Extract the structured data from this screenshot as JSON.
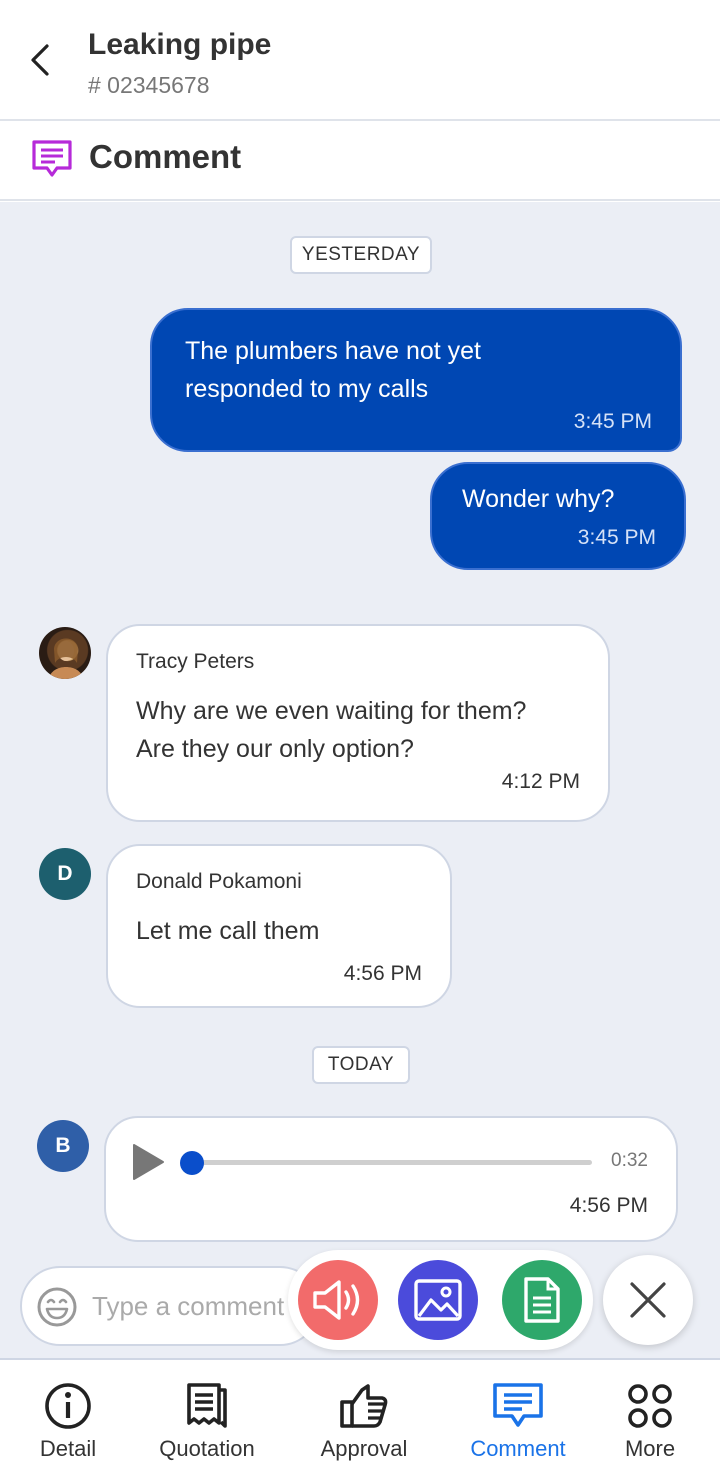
{
  "header": {
    "title": "Leaking pipe",
    "ticket": "# 02345678"
  },
  "section": {
    "title": "Comment",
    "icon": "comment-icon",
    "icon_color": "#b62ad9"
  },
  "dates": {
    "yesterday": "YESTERDAY",
    "today": "TODAY"
  },
  "messages_out": [
    {
      "text_line1": "The plumbers have not yet",
      "text_line2": "responded to my calls",
      "time": "3:45 PM"
    },
    {
      "text": "Wonder why?",
      "time": "3:45 PM"
    }
  ],
  "messages_in": [
    {
      "sender": "Tracy Peters",
      "text_line1": "Why are we even waiting for them?",
      "text_line2": "Are they our only option?",
      "time": "4:12 PM"
    },
    {
      "sender": "Donald Pokamoni",
      "initial": "D",
      "text": "Let me call them",
      "time": "4:56 PM"
    }
  ],
  "voice_message": {
    "initial": "B",
    "duration": "0:32",
    "time": "4:56 PM",
    "progress": 0
  },
  "composer": {
    "placeholder": "Type a comment"
  },
  "attachments": [
    {
      "name": "audio-icon",
      "color": "#f26b6b"
    },
    {
      "name": "image-icon",
      "color": "#4b4bdb"
    },
    {
      "name": "document-icon",
      "color": "#2ea86b"
    }
  ],
  "nav": [
    {
      "label": "Detail",
      "icon": "info-icon"
    },
    {
      "label": "Quotation",
      "icon": "receipt-icon"
    },
    {
      "label": "Approval",
      "icon": "thumbs-up-icon"
    },
    {
      "label": "Comment",
      "icon": "comment-icon",
      "active": true
    },
    {
      "label": "More",
      "icon": "grid-icon"
    }
  ],
  "colors": {
    "accent": "#1a73e8",
    "outgoing_bubble": "#0047b3",
    "chat_bg": "#ebeef5"
  }
}
